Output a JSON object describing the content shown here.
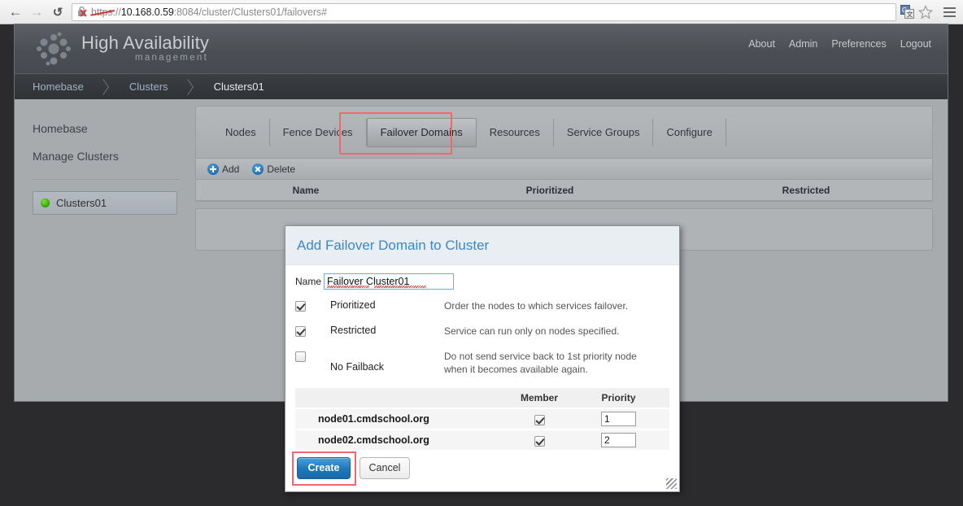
{
  "browser": {
    "back_icon": "back-arrow-icon",
    "forward_icon": "forward-arrow-icon",
    "reload_icon": "reload-icon",
    "url_scheme": "https",
    "url_sep": "://",
    "url_host": "10.168.0.59",
    "url_rest": ":8084/cluster/Clusters01/failovers#",
    "url_full": "https://10.168.0.59:8084/cluster/Clusters01/failovers#",
    "security_icon": "broken-certificate-icon",
    "translate_icon": "translate-icon",
    "bookmark_icon": "star-icon",
    "menu_icon": "hamburger-menu-icon"
  },
  "header": {
    "logo_icon": "dot-cluster-logo",
    "brand_main": "High Availability",
    "brand_sub": "management",
    "nav": [
      {
        "label": "About"
      },
      {
        "label": "Admin"
      },
      {
        "label": "Preferences"
      },
      {
        "label": "Logout"
      }
    ]
  },
  "breadcrumb": {
    "items": [
      {
        "label": "Homebase",
        "current": false
      },
      {
        "label": "Clusters",
        "current": false
      },
      {
        "label": "Clusters01",
        "current": true
      }
    ]
  },
  "sidebar": {
    "links": [
      {
        "label": "Homebase"
      },
      {
        "label": "Manage Clusters"
      }
    ],
    "cluster": {
      "label": "Clusters01",
      "status_icon": "green-status-dot",
      "status_color": "#3fbf0a"
    }
  },
  "tabs": [
    {
      "label": "Nodes",
      "active": false
    },
    {
      "label": "Fence Devices",
      "active": false
    },
    {
      "label": "Failover Domains",
      "active": true
    },
    {
      "label": "Resources",
      "active": false
    },
    {
      "label": "Service Groups",
      "active": false
    },
    {
      "label": "Configure",
      "active": false
    }
  ],
  "toolbar": {
    "add_label": "Add",
    "add_icon": "plus-circle-icon",
    "delete_label": "Delete",
    "delete_icon": "x-circle-icon"
  },
  "table": {
    "columns": [
      {
        "label": "Name"
      },
      {
        "label": "Prioritized"
      },
      {
        "label": "Restricted"
      }
    ],
    "rows": []
  },
  "annotations": {
    "color": "#f0686b",
    "tab_highlight": "Failover Domains",
    "button_highlight": "Create"
  },
  "modal": {
    "title": "Add Failover Domain to Cluster",
    "name_label": "Name",
    "name_value": "Failover Cluster01",
    "name_placeholder": "",
    "options": [
      {
        "label": "Prioritized",
        "checked": true,
        "description": "Order the nodes to which services failover."
      },
      {
        "label": "Restricted",
        "checked": true,
        "description": "Service can run only on nodes specified."
      },
      {
        "label": "No Failback",
        "checked": false,
        "description": "Do not send service back to 1st priority node when it becomes available again."
      }
    ],
    "member_table": {
      "columns": [
        {
          "label": ""
        },
        {
          "label": "Member"
        },
        {
          "label": "Priority"
        }
      ],
      "rows": [
        {
          "name": "node01.cmdschool.org",
          "member": true,
          "priority": "1"
        },
        {
          "name": "node02.cmdschool.org",
          "member": true,
          "priority": "2"
        }
      ]
    },
    "create_label": "Create",
    "cancel_label": "Cancel",
    "resize_icon": "resize-grip-icon"
  }
}
